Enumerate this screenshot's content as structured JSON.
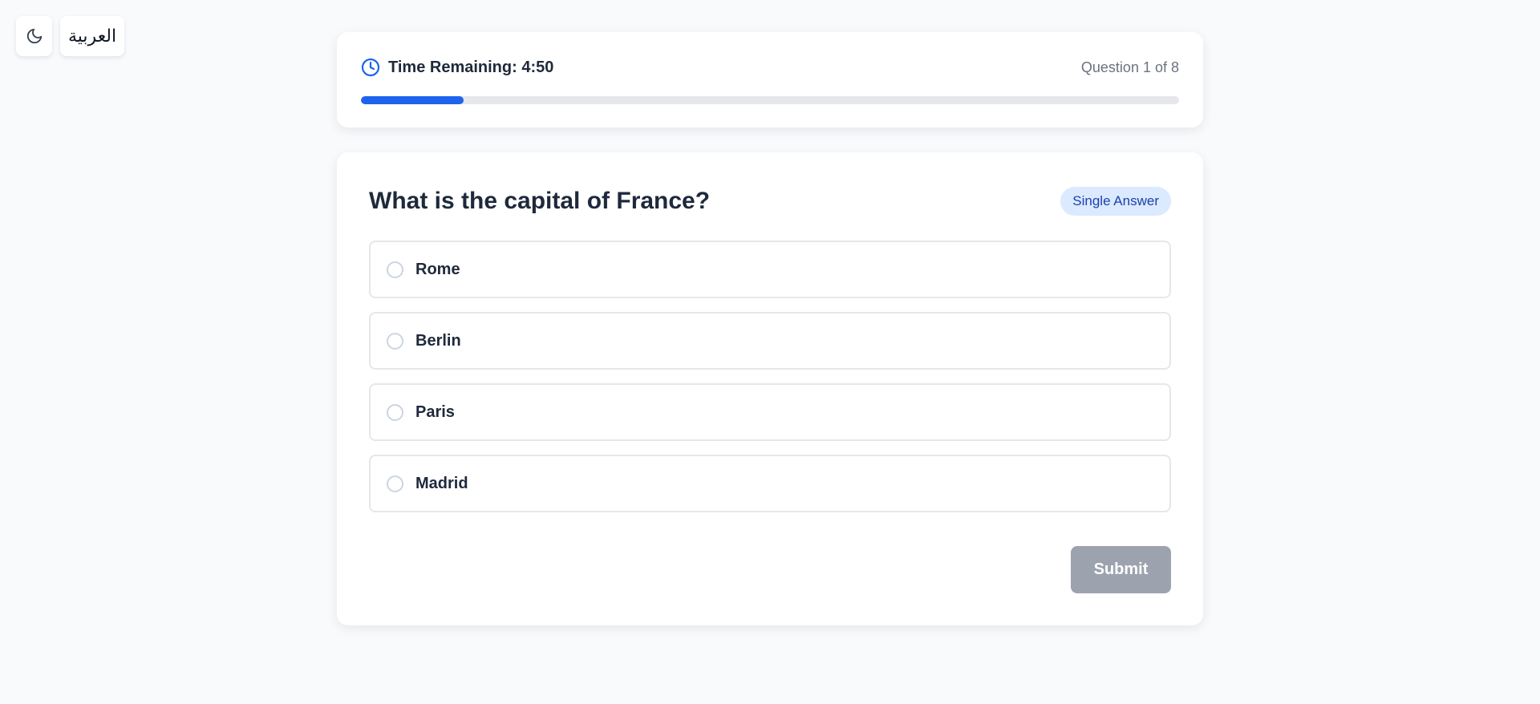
{
  "controls": {
    "theme_icon": "moon-icon",
    "language_label": "العربية"
  },
  "timer": {
    "icon": "clock-icon",
    "label": "Time Remaining: 4:50",
    "question_counter": "Question 1 of 8",
    "progress_fraction": 0.125,
    "progress_color": "#1d63ed"
  },
  "question": {
    "title": "What is the capital of France?",
    "type_badge": "Single Answer",
    "options": [
      {
        "label": "Rome"
      },
      {
        "label": "Berlin"
      },
      {
        "label": "Paris"
      },
      {
        "label": "Madrid"
      }
    ],
    "submit_label": "Submit",
    "submit_disabled": true
  }
}
